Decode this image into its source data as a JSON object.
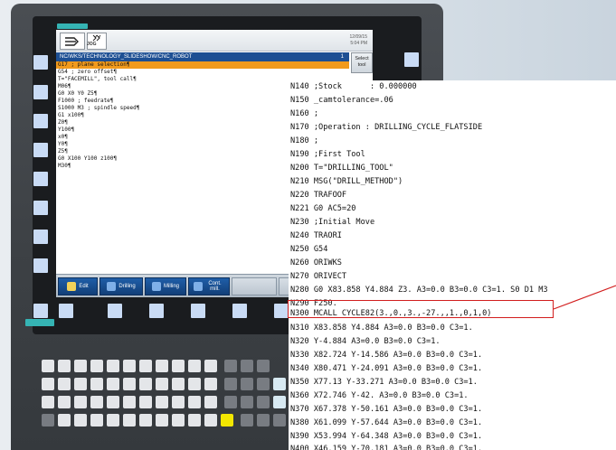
{
  "window": {
    "mode_label": "JOG",
    "clock_date": "12/09/15",
    "clock_time": "5:04 PM",
    "path": "NC/WKS/TECHNOLOGY_SLIDESHOW/CNC_ROBOT",
    "path_badge": "1",
    "select_tool": "Select tool"
  },
  "program": {
    "lines": [
      "G17 ; plane selection¶",
      "G54 ; zero offset¶",
      "T=\"FACEMILL\", tool call¶",
      "M06¶",
      "G0 X0 Y0 Z5¶",
      "F1000 ; feedrate¶",
      "S1000 M3 ; spindle speed¶",
      "G1 x100¶",
      "Z0¶",
      "Y100¶",
      "x0¶",
      "Y0¶",
      "Z5¶",
      "G0 X100 Y100 z100¶",
      "M30¶"
    ],
    "active_line": 0
  },
  "softkeys": {
    "edit": "Edit",
    "drilling": "Drilling",
    "milling": "Milling",
    "cont_mill": "Cont. mill."
  },
  "nc_listing": {
    "lines": [
      "N140 ;Stock      : 0.000000",
      "N150 _camtolerance=.06",
      "N160 ;",
      "N170 ;Operation : DRILLING_CYCLE_FLATSIDE",
      "N180 ;",
      "N190 ;First Tool",
      "N200 T=\"DRILLING_TOOL\"",
      "N210 MSG(\"DRILL_METHOD\")",
      "N220 TRAFOOF",
      "N221 G0 AC5=20",
      "N230 ;Initial Move",
      "N240 TRAORI",
      "N250 G54",
      "N260 ORIWKS",
      "N270 ORIVECT",
      "N280 G0 X83.858 Y4.884 Z3. A3=0.0 B3=0.0 C3=1. S0 D1 M3",
      "N290 F250.",
      "N300 MCALL CYCLE82(3.,0.,3.,-27.,,1.,0,1,0)",
      "N310 X83.858 Y4.884 A3=0.0 B3=0.0 C3=1.",
      "N320 Y-4.884 A3=0.0 B3=0.0 C3=1.",
      "N330 X82.724 Y-14.586 A3=0.0 B3=0.0 C3=1.",
      "N340 X80.471 Y-24.091 A3=0.0 B3=0.0 C3=1.",
      "N350 X77.13 Y-33.271 A3=0.0 B3=0.0 C3=1.",
      "N360 X72.746 Y-42. A3=0.0 B3=0.0 C3=1.",
      "N370 X67.378 Y-50.161 A3=0.0 B3=0.0 C3=1.",
      "N380 X61.099 Y-57.644 A3=0.0 B3=0.0 C3=1.",
      "N390 X53.994 Y-64.348 A3=0.0 B3=0.0 C3=1.",
      "N400 X46.159 Y-70.181 A3=0.0 B3=0.0 C3=1."
    ],
    "highlighted_line": "N300 MCALL CYCLE82(3.,0.,3.,-27.,,1.,0,1,0)"
  },
  "colors": {
    "active_line": "#f19a1d",
    "path_bar": "#1d4f93",
    "highlight": "#d21e1e",
    "led": "#35b4b4"
  }
}
